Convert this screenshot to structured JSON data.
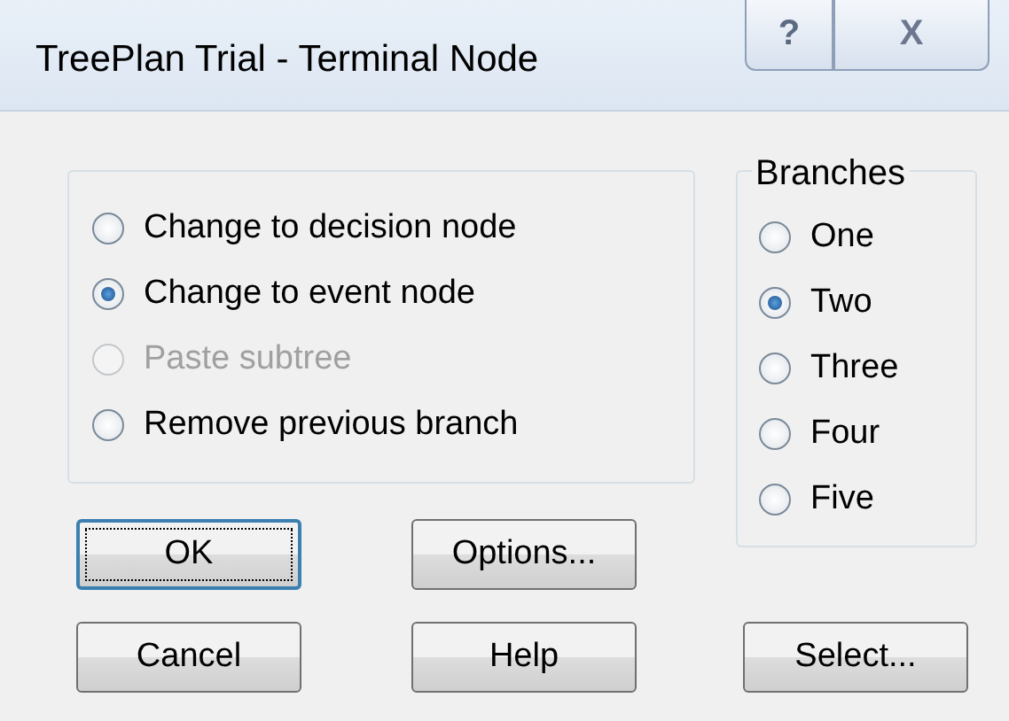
{
  "window": {
    "title": "TreePlan Trial - Terminal Node",
    "caption_buttons": [
      "?",
      "X"
    ]
  },
  "actions": [
    {
      "label": "Change to decision node",
      "selected": false,
      "disabled": false
    },
    {
      "label": "Change to event node",
      "selected": true,
      "disabled": false
    },
    {
      "label": "Paste subtree",
      "selected": false,
      "disabled": true
    },
    {
      "label": "Remove previous branch",
      "selected": false,
      "disabled": false
    }
  ],
  "branches": {
    "title": "Branches",
    "options": [
      {
        "label": "One",
        "selected": false
      },
      {
        "label": "Two",
        "selected": true
      },
      {
        "label": "Three",
        "selected": false
      },
      {
        "label": "Four",
        "selected": false
      },
      {
        "label": "Five",
        "selected": false
      }
    ]
  },
  "buttons_row1": [
    {
      "label": "OK",
      "focused": true
    },
    {
      "label": "Options...",
      "focused": false
    }
  ],
  "buttons_row2": [
    {
      "label": "Cancel",
      "focused": false
    },
    {
      "label": "Help",
      "focused": false
    },
    {
      "label": "Select...",
      "focused": false
    }
  ]
}
